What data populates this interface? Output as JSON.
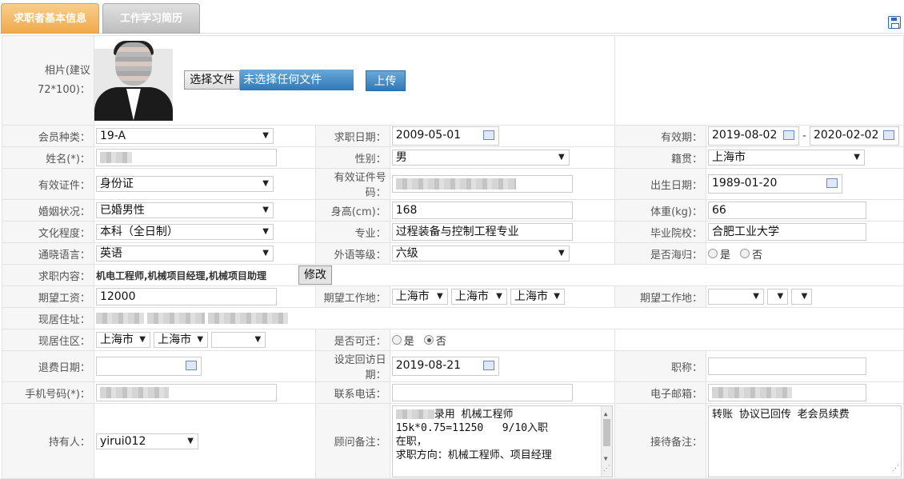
{
  "tabs": {
    "basic": "求职者基本信息",
    "resume": "工作学习简历"
  },
  "photo": {
    "label1": "相片(建议",
    "label2": "72*100)：",
    "choose_btn": "选择文件",
    "file_status": "未选择任何文件",
    "upload_btn": "上传"
  },
  "labels": {
    "member_type": "会员种类：",
    "apply_date": "求职日期：",
    "valid_period": "有效期：",
    "name": "姓名(*)：",
    "gender": "性别：",
    "native": "籍贯：",
    "id_type": "有效证件：",
    "id_no": "有效证件号码：",
    "birth": "出生日期：",
    "marital": "婚姻状况：",
    "height": "身高(cm)：",
    "weight": "体重(kg)：",
    "education": "文化程度：",
    "major": "专业：",
    "school": "毕业院校：",
    "language": "通晓语言：",
    "lang_level": "外语等级：",
    "overseas": "是否海归：",
    "job_content": "求职内容：",
    "salary": "期望工资：",
    "work_place": "期望工作地：",
    "work_place2": "期望工作地：",
    "address": "现居住址：",
    "district": "现居住区：",
    "relocate": "是否可迁：",
    "refund_date": "退费日期：",
    "revisit_date": "设定回访日期：",
    "title": "职称：",
    "mobile": "手机号码(*)：",
    "phone": "联系电话：",
    "email": "电子邮箱：",
    "holder": "持有人：",
    "advisor_note": "顾问备注：",
    "reception_note": "接待备注："
  },
  "values": {
    "member_type": "19-A",
    "apply_date": "2009-05-01",
    "valid_from": "2019-08-02",
    "valid_sep": "-",
    "valid_to": "2020-02-02",
    "gender": "男",
    "native": "上海市",
    "id_type": "身份证",
    "birth": "1989-01-20",
    "marital": "已婚男性",
    "height": "168",
    "weight": "66",
    "education": "本科（全日制）",
    "major": "过程装备与控制工程专业",
    "school": "合肥工业大学",
    "language": "英语",
    "lang_level": "六级",
    "yes": "是",
    "no": "否",
    "job_content": "机电工程师,机械项目经理,机械项目助理",
    "modify_btn": "修改",
    "salary": "12000",
    "wp1": "上海市",
    "wp2": "上海市",
    "wp3": "上海市",
    "district1": "上海市",
    "district2": "上海市",
    "revisit_date": "2019-08-21",
    "holder": "yirui012",
    "advisor_note_l1": "录用 机械工程师",
    "advisor_note_rest": "15k*0.75=11250   9/10入职\n在职，\n求职方向：机械工程师、项目经理",
    "reception_note": "转账 协议已回传 老会员续费"
  }
}
